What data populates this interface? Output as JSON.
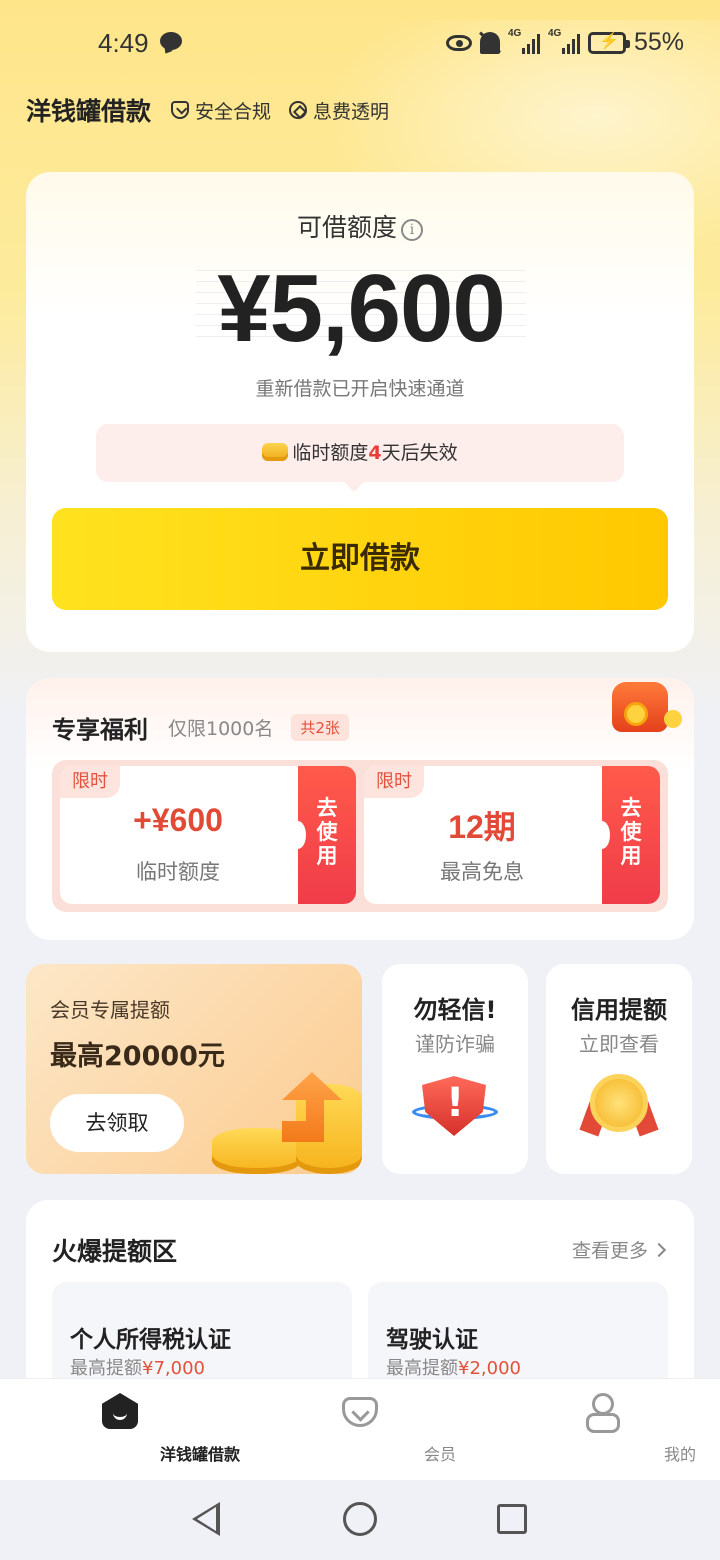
{
  "status_bar": {
    "time": "4:49",
    "network1": "4G",
    "network2": "4G",
    "battery": "55%"
  },
  "header": {
    "title": "洋钱罐借款",
    "tag1": "安全合规",
    "tag2": "息费透明"
  },
  "main": {
    "limit_label": "可借额度",
    "amount": "¥5,600",
    "sub": "重新借款已开启快速通道",
    "tip_prefix": "临时额度",
    "tip_days": "4",
    "tip_suffix": "天后失效",
    "borrow_label": "立即借款"
  },
  "benefits": {
    "title": "专享福利",
    "subtitle": "仅限1000名",
    "count": "共2张",
    "coupons": [
      {
        "tag": "限时",
        "value": "+¥600",
        "desc": "临时额度",
        "use": "去\n使\n用"
      },
      {
        "tag": "限时",
        "value": "12期",
        "desc": "最高免息",
        "use": "去\n使\n用"
      }
    ]
  },
  "member": {
    "sub": "会员专属提额",
    "title": "最高20000元",
    "button": "去领取"
  },
  "cards": [
    {
      "title": "勿轻信!",
      "sub": "谨防诈骗"
    },
    {
      "title": "信用提额",
      "sub": "立即查看"
    }
  ],
  "hot": {
    "title": "火爆提额区",
    "more": "查看更多",
    "items": [
      {
        "title": "个人所得税认证",
        "sub_prefix": "最高提额",
        "sub_value": "¥7,000"
      },
      {
        "title": "驾驶认证",
        "sub_prefix": "最高提额",
        "sub_value": "¥2,000"
      }
    ]
  },
  "nav": {
    "home": "洋钱罐借款",
    "vip": "会员",
    "mine": "我的"
  },
  "colors": {
    "accent_yellow": "#ffd200",
    "accent_red": "#e3513a"
  }
}
